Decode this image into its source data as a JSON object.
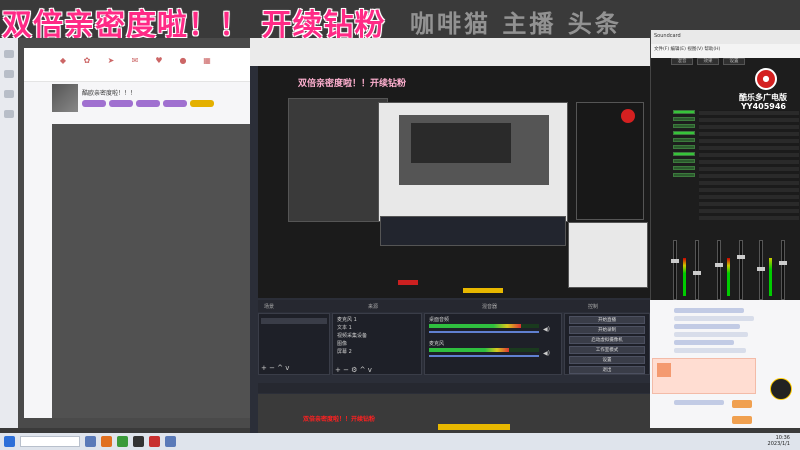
{
  "banner": {
    "text": "双倍亲密度啦！！ 开续钻粉",
    "tail": "咖啡猫 主播 头条"
  },
  "live_room": {
    "title": "酷欧亲密度啦！！！",
    "tags": [
      "",
      "",
      "",
      "",
      ""
    ]
  },
  "obs": {
    "preview_title": "双倍亲密度啦！！开续钻粉",
    "dock_titles": {
      "scenes": "场景",
      "sources": "来源",
      "mixer": "混音器",
      "transitions": "转场",
      "controls": "控制"
    },
    "sources": [
      "麦克风 1",
      "文本 1",
      "视频采集设备",
      "图像",
      "屏幕 2"
    ],
    "mixer_tracks": [
      "桌面音频",
      "麦克风"
    ],
    "controls": [
      "开始直播",
      "开始录制",
      "启动虚拟摄像机",
      "工作室模式",
      "设置",
      "退出"
    ],
    "bottom_red_text": "双倍亲密度啦！！开续钻粉"
  },
  "mixer_app": {
    "title": "Soundcard",
    "menu": "文件(F) 编辑(E) 视图(V) 帮助(H)",
    "tabs": [
      "混音",
      "效果",
      "设置"
    ],
    "station": "酷乐多广电版",
    "station_id": "YY405946"
  },
  "taskbar": {
    "time": "10:36",
    "date": "2023/1/1"
  },
  "colors": {
    "banner": "#ff2a86",
    "obs_bg": "#2b2e38",
    "meter_green": "#2fbf3f",
    "accent_red": "#d42020",
    "taskbar": "#dfe4ec"
  },
  "icons": {
    "mixer_logo": "red-circle-logo",
    "start": "windows-start-icon",
    "search": "search-icon"
  }
}
